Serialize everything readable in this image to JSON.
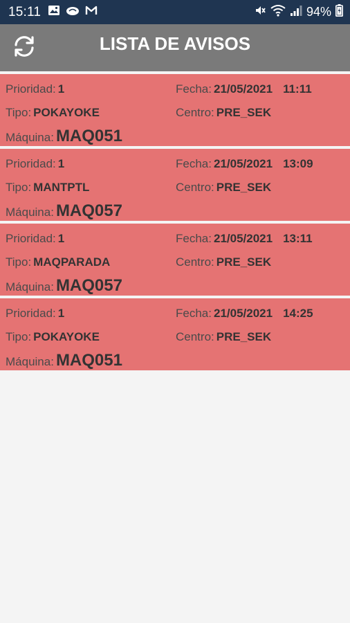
{
  "status_bar": {
    "time": "15:11",
    "battery_percent": "94%",
    "left_icons": [
      "image-icon",
      "cloud-icon",
      "mail-icon"
    ],
    "right_icons": [
      "mute-icon",
      "wifi-icon",
      "signal-icon",
      "battery-icon"
    ]
  },
  "app_bar": {
    "title": "LISTA DE AVISOS",
    "refresh_icon": "refresh-icon",
    "background": "#7a7a7a"
  },
  "colors": {
    "status_bar": "#1f3551",
    "card": "#e57373",
    "page_bg": "#f4f4f4"
  },
  "labels": {
    "prioridad": "Prioridad:",
    "fecha": "Fecha:",
    "tipo": "Tipo:",
    "centro": "Centro:",
    "maquina": "Máquina:"
  },
  "avisos": [
    {
      "prioridad": "1",
      "fecha": "21/05/2021",
      "hora": "11:11",
      "tipo": "POKAYOKE",
      "centro": "PRE_SEK",
      "maquina": "MAQ051"
    },
    {
      "prioridad": "1",
      "fecha": "21/05/2021",
      "hora": "13:09",
      "tipo": "MANTPTL",
      "centro": "PRE_SEK",
      "maquina": "MAQ057"
    },
    {
      "prioridad": "1",
      "fecha": "21/05/2021",
      "hora": "13:11",
      "tipo": "MAQPARADA",
      "centro": "PRE_SEK",
      "maquina": "MAQ057"
    },
    {
      "prioridad": "1",
      "fecha": "21/05/2021",
      "hora": "14:25",
      "tipo": "POKAYOKE",
      "centro": "PRE_SEK",
      "maquina": "MAQ051"
    }
  ]
}
